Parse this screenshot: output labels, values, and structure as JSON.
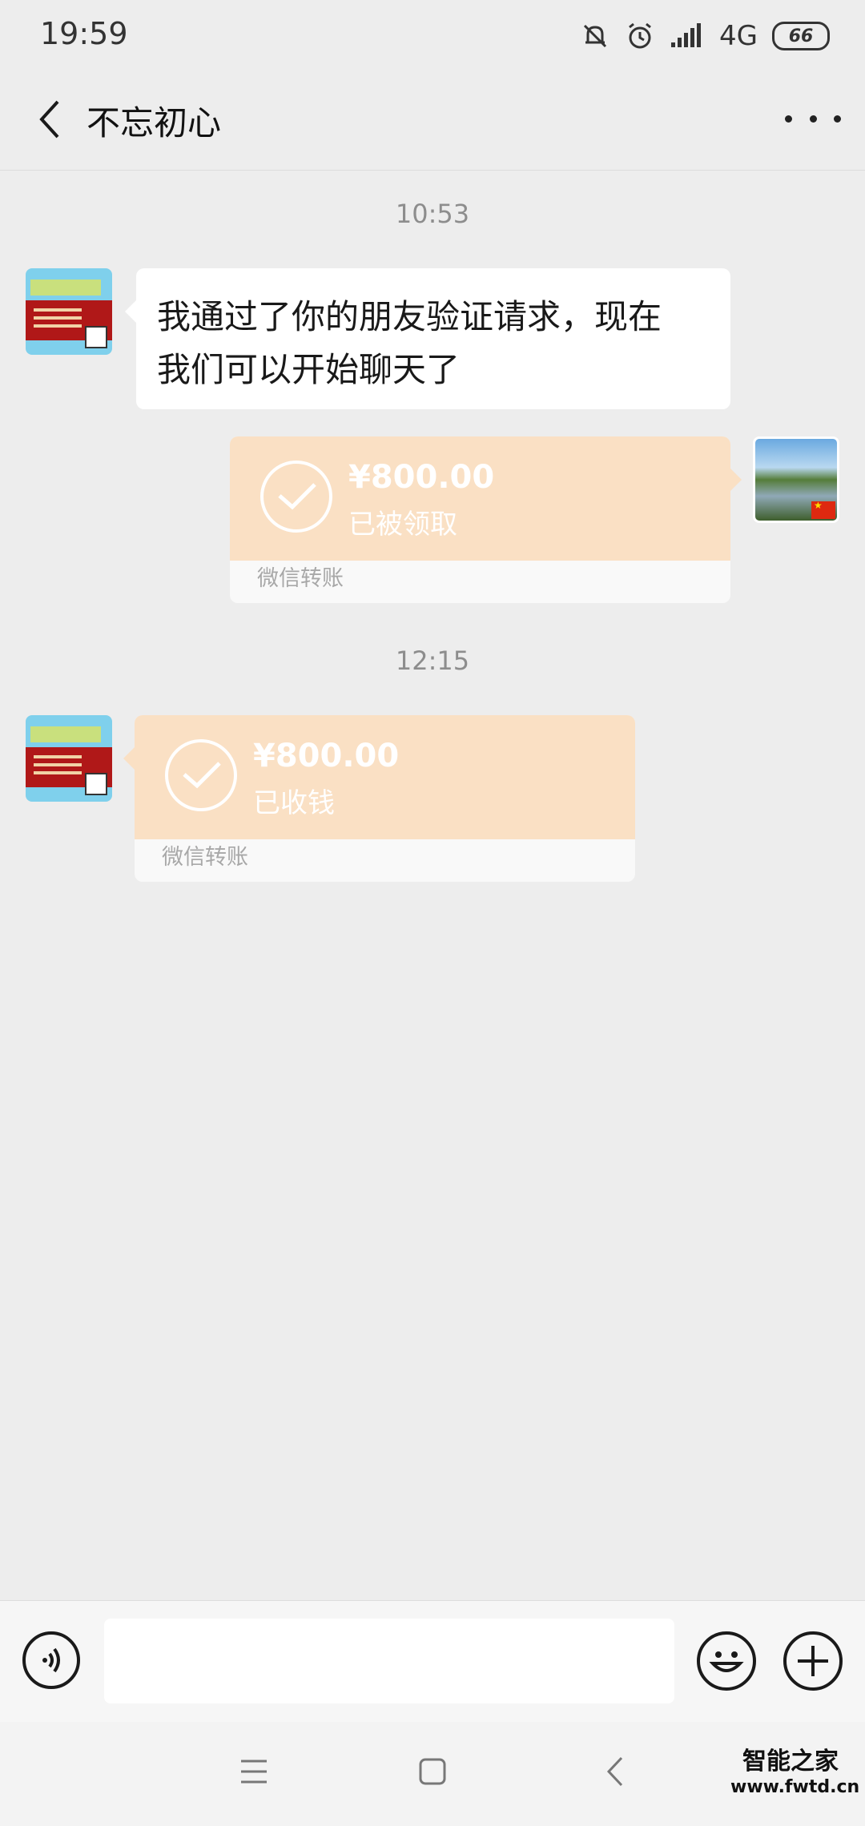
{
  "status_bar": {
    "time": "19:59",
    "network": "4G",
    "battery": "66",
    "icons": [
      "mute-bell-icon",
      "alarm-icon",
      "signal-icon"
    ]
  },
  "header": {
    "title": "不忘初心",
    "back_icon": "chevron-left-icon",
    "more_icon": "more-dots-icon"
  },
  "messages": [
    {
      "type": "timestamp",
      "text": "10:53"
    },
    {
      "type": "text",
      "side": "left",
      "text_line1": "我通过了你的朋友验证请求，现在",
      "text_line2": "我们可以开始聊天了"
    },
    {
      "type": "transfer",
      "side": "right",
      "amount": "¥800.00",
      "status": "已被领取",
      "label": "微信转账"
    },
    {
      "type": "timestamp",
      "text": "12:15"
    },
    {
      "type": "transfer",
      "side": "left",
      "amount": "¥800.00",
      "status": "已收钱",
      "label": "微信转账"
    }
  ],
  "input_bar": {
    "placeholder": "",
    "voice_icon": "voice-icon",
    "emoji_icon": "emoji-icon",
    "plus_icon": "plus-icon"
  },
  "nav_bar": {
    "icons": [
      "menu-icon",
      "home-icon",
      "back-icon"
    ]
  },
  "watermark": {
    "line1": "智能之家",
    "line2": "www.fwtd.cn"
  },
  "colors": {
    "background": "#ededed",
    "transfer_bg": "#fae0c4",
    "bubble_bg": "#ffffff"
  }
}
